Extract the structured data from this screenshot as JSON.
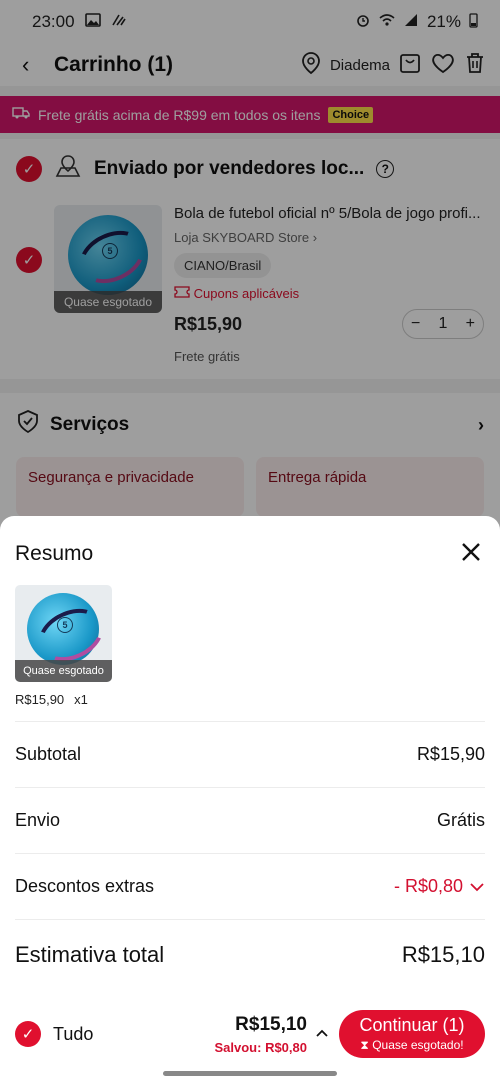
{
  "status_bar": {
    "time": "23:00",
    "battery": "21%"
  },
  "header": {
    "back": "‹",
    "title": "Carrinho (1)",
    "location": "Diadema"
  },
  "promo": {
    "text": "Frete grátis acima de R$99 em todos os itens",
    "tag": "Choice"
  },
  "seller": {
    "title": "Enviado por vendedores loc...",
    "help": "?"
  },
  "item": {
    "title": "Bola de futebol oficial nº 5/Bola de jogo profi...",
    "store": "Loja SKYBOARD Store",
    "variant": "CIANO/Brasil",
    "coupons": "Cupons aplicáveis",
    "price": "R$15,90",
    "quantity": "1",
    "shipping": "Frete grátis",
    "badge": "Quase esgotado"
  },
  "services": {
    "title": "Serviços",
    "cards": [
      "Segurança e privacidade",
      "Entrega rápida"
    ]
  },
  "summary": {
    "title": "Resumo",
    "thumb_badge": "Quase esgotado",
    "unit_price": "R$15,90",
    "qty": "x1",
    "subtotal_label": "Subtotal",
    "subtotal_value": "R$15,90",
    "shipping_label": "Envio",
    "shipping_value": "Grátis",
    "discount_label": "Descontos extras",
    "discount_value": "- R$0,80",
    "total_label": "Estimativa total",
    "total_value": "R$15,10"
  },
  "footer": {
    "all_label": "Tudo",
    "total": "R$15,10",
    "saved": "Salvou: R$0,80",
    "continue_label": "Continuar (1)",
    "continue_sub": "Quase esgotado!"
  },
  "colors": {
    "accent": "#e0102f",
    "promo_bg": "#d4166b",
    "choice_tag": "#ffe14a",
    "discount": "#d31030"
  }
}
